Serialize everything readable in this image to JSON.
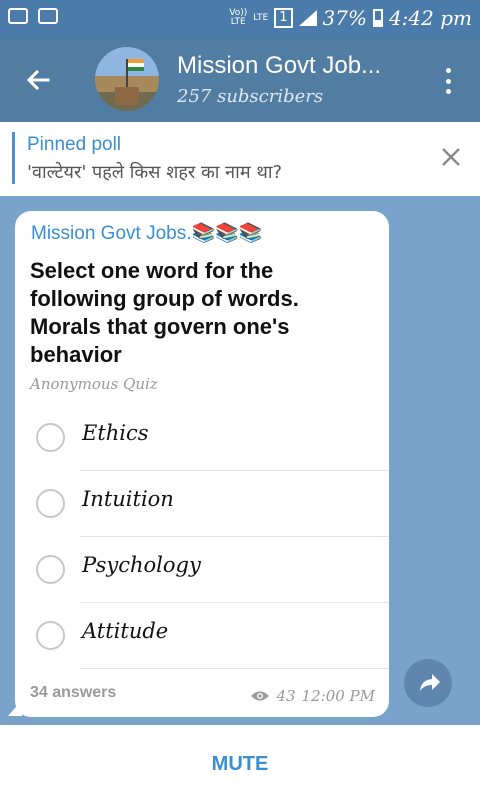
{
  "status_bar": {
    "net_top": "Vo))",
    "net_bottom": "LTE",
    "lte_label": "LTE",
    "sim_slot": "1",
    "battery": "37%",
    "time": "4:42 pm"
  },
  "header": {
    "title": "Mission Govt Job...",
    "subtitle": "257 subscribers"
  },
  "pinned": {
    "title": "Pinned poll",
    "text": "'वाल्टेयर' पहले किस शहर का नाम था?"
  },
  "message": {
    "sender": "Mission Govt Jobs.",
    "sender_emoji": "📚📚📚",
    "question": "Select one word for the following group of words. Morals that govern one's behavior",
    "quiz_type": "Anonymous Quiz",
    "options": [
      "Ethics",
      "Intuition",
      "Psychology",
      "Attitude"
    ],
    "answers": "34 answers",
    "views": "43",
    "time": "12:00 PM"
  },
  "bottom": {
    "mute_label": "MUTE"
  },
  "colors": {
    "header": "#527da3",
    "status_bar": "#4b7bab",
    "accent": "#3a8fd1",
    "chat_bg": "#7aa3cc"
  },
  "icons": {
    "back": "arrow-left-icon",
    "menu": "more-vertical-icon",
    "close": "close-icon",
    "views": "eye-icon",
    "share": "share-arrow-icon"
  }
}
